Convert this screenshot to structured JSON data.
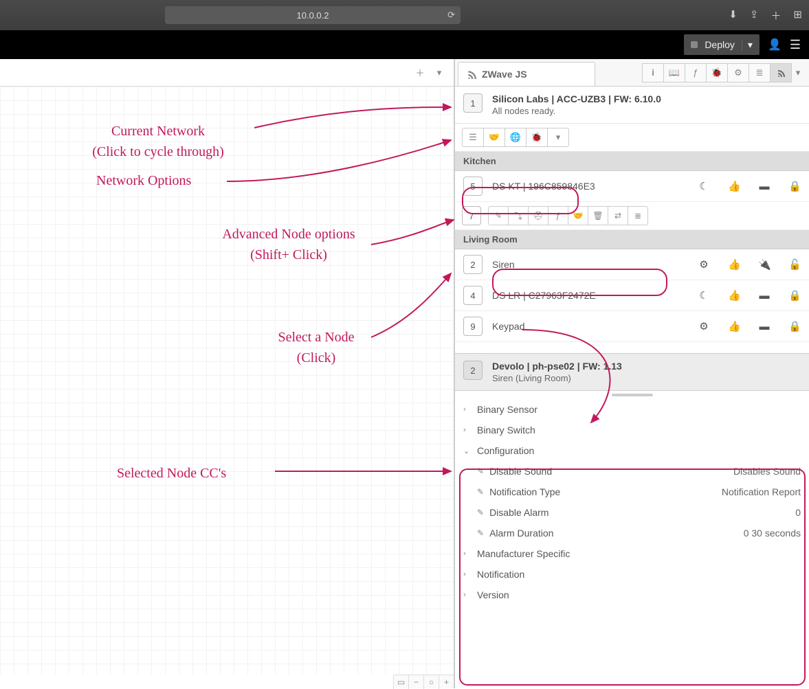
{
  "browser": {
    "url": "10.0.0.2"
  },
  "header": {
    "deploy_label": "Deploy"
  },
  "sidebar_tab": {
    "title": "ZWave JS"
  },
  "controller": {
    "id": "1",
    "title": "Silicon Labs | ACC-UZB3 | FW: 6.10.0",
    "status": "All nodes ready."
  },
  "rooms": [
    {
      "name": "Kitchen",
      "nodes": [
        {
          "id": "5",
          "label": "DS KT | 196C859846E3",
          "icons": [
            "moon",
            "thumb",
            "battery",
            "lock-s2"
          ]
        }
      ],
      "advanced_node": {
        "id": "7"
      }
    },
    {
      "name": "Living Room",
      "nodes": [
        {
          "id": "2",
          "label": "Siren",
          "icons": [
            "gear",
            "thumb",
            "plug",
            "unlock"
          ]
        },
        {
          "id": "4",
          "label": "DS LR | C27963F2472E",
          "icons": [
            "moon",
            "thumb",
            "battery",
            "lock-s2"
          ]
        },
        {
          "id": "9",
          "label": "Keypad",
          "icons": [
            "gear",
            "thumb",
            "battery",
            "lock-s2"
          ]
        }
      ]
    }
  ],
  "selected": {
    "id": "2",
    "title": "Devolo | ph-pse02 | FW: 1.13",
    "sub": "Siren (Living Room)"
  },
  "cc": {
    "items": [
      {
        "label": "Binary Sensor",
        "open": false
      },
      {
        "label": "Binary Switch",
        "open": false
      },
      {
        "label": "Configuration",
        "open": true,
        "params": [
          {
            "name": "Disable Sound",
            "value": "Disables Sound"
          },
          {
            "name": "Notification Type",
            "value": "Notification Report"
          },
          {
            "name": "Disable Alarm",
            "value": "0"
          },
          {
            "name": "Alarm Duration",
            "value": "0 30 seconds"
          }
        ]
      },
      {
        "label": "Manufacturer Specific",
        "open": false
      },
      {
        "label": "Notification",
        "open": false
      },
      {
        "label": "Version",
        "open": false
      }
    ]
  },
  "annotations": {
    "a1": "Current Network\n(Click to cycle through)",
    "a2": "Network Options",
    "a3": "Advanced Node options\n(Shift+ Click)",
    "a4": "Select a Node\n(Click)",
    "a5": "Selected Node CC's"
  }
}
